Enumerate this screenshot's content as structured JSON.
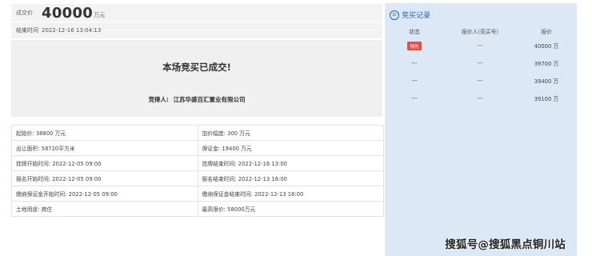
{
  "deal": {
    "price_label": "成交价",
    "price_value": "40000",
    "price_unit": "万元",
    "end_label": "结束时间",
    "end_value": "2022-12-16 13:04:13",
    "result_title": "本场竞买已成交!",
    "winner_label": "竞得人:",
    "winner_value": "江苏华盛百汇置业有限公司"
  },
  "info": [
    [
      "起始价: 38800 万元",
      "加价幅度: 300 万元"
    ],
    [
      "出让面积: 58720平方米",
      "保证金: 19400 万元"
    ],
    [
      "挂牌开始时间: 2022-12-05 09:00",
      "挂牌结束时间: 2022-12-16 13:00"
    ],
    [
      "报名开始时间: 2022-12-05 09:00",
      "报名结束时间: 2022-12-13 16:00"
    ],
    [
      "缴纳保证金开始时间: 2022-12-05 09:00",
      "缴纳保证金结束时间: 2022-12-13 16:00"
    ],
    [
      "土地用途: 商住",
      "最高限价: 58000万元"
    ]
  ],
  "bids": {
    "icon": "gavel-icon",
    "title": "竞买记录",
    "headers": [
      "状态",
      "报价人(竞买号)",
      "报价"
    ],
    "rows": [
      {
        "status": "领先",
        "bidder": "---",
        "price": "40000 万"
      },
      {
        "status": "---",
        "bidder": "---",
        "price": "39700 万"
      },
      {
        "status": "---",
        "bidder": "---",
        "price": "39400 万"
      },
      {
        "status": "---",
        "bidder": "---",
        "price": "39100 万"
      }
    ]
  },
  "watermark": "搜狐号@搜狐黑点铜川站"
}
